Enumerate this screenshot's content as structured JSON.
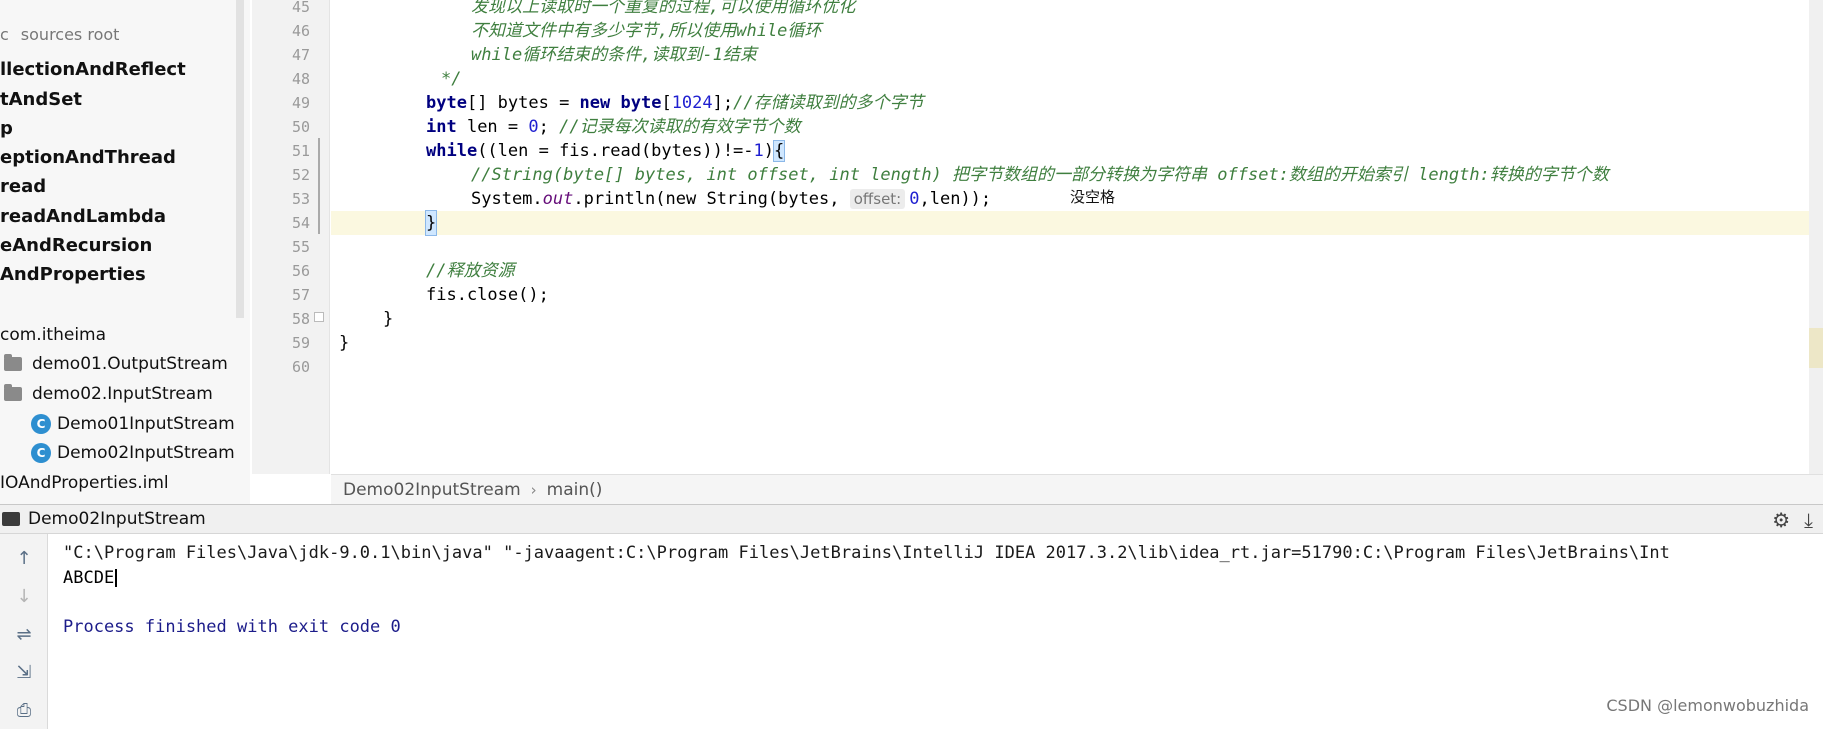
{
  "project_tree": {
    "items": [
      {
        "label": "sources root",
        "prefix": "c"
      },
      {
        "label": "llectionAndReflect"
      },
      {
        "label": "tAndSet"
      },
      {
        "label": "p"
      },
      {
        "label": "eptionAndThread"
      },
      {
        "label": "read"
      },
      {
        "label": "readAndLambda"
      },
      {
        "label": "eAndRecursion"
      },
      {
        "label": "AndProperties"
      },
      {
        "label": "com.itheima"
      },
      {
        "label": "demo01.OutputStream"
      },
      {
        "label": "demo02.InputStream"
      },
      {
        "label": "Demo01InputStream"
      },
      {
        "label": "Demo02InputStream"
      },
      {
        "label": "IOAndProperties.iml"
      }
    ]
  },
  "editor": {
    "line_numbers": [
      "45",
      "46",
      "47",
      "48",
      "49",
      "50",
      "51",
      "52",
      "53",
      "54",
      "55",
      "56",
      "57",
      "58",
      "59",
      "60"
    ],
    "lines": {
      "l45": "发现以上读取时一个重复的过程,可以使用循环优化",
      "l46a": "不知道文件中有多少字节,所以使用",
      "l46b": "while",
      "l46c": "循环",
      "l47a": "while",
      "l47b": "循环结束的条件,读取到-1结束",
      "l48": "*/",
      "l49_kw1": "byte",
      "l49_a": "[] bytes = ",
      "l49_kw2": "new byte",
      "l49_b": "[",
      "l49_num": "1024",
      "l49_c": "];",
      "l49_cm": "//存储读取到的多个字节",
      "l50_kw": "int",
      "l50_a": " len = ",
      "l50_num": "0",
      "l50_b": "; ",
      "l50_cm": "//记录每次读取的有效字节个数",
      "l51_kw": "while",
      "l51_a": "((len = fis.read(bytes))!=-",
      "l51_num": "1",
      "l51_b": ")",
      "l51_brace": "{",
      "l52_cm": "//String(byte[] bytes, int offset, int length) 把字节数组的一部分转换为字符串 offset:数组的开始索引 length:转换的字节个数",
      "l53_a": "System.",
      "l53_fld": "out",
      "l53_b": ".println(",
      "l53_kw": "new",
      "l53_c": " String(bytes, ",
      "l53_hint": "offset:",
      "l53_num": "0",
      "l53_d": ",len));",
      "l54_brace": "}",
      "l56_cm": "//释放资源",
      "l57": "fis.close();",
      "l58": "}",
      "l59": "}"
    },
    "annotation": "没空格",
    "breadcrumb": {
      "class": "Demo02InputStream",
      "method": "main()"
    }
  },
  "run_panel": {
    "tab_label": "Demo02InputStream",
    "console": {
      "command": "\"C:\\Program Files\\Java\\jdk-9.0.1\\bin\\java\" \"-javaagent:C:\\Program Files\\JetBrains\\IntelliJ IDEA 2017.3.2\\lib\\idea_rt.jar=51790:C:\\Program Files\\JetBrains\\Int",
      "output": "ABCDE",
      "exit_message": "Process finished with exit code 0"
    }
  },
  "watermark": "CSDN @lemonwobuzhida"
}
